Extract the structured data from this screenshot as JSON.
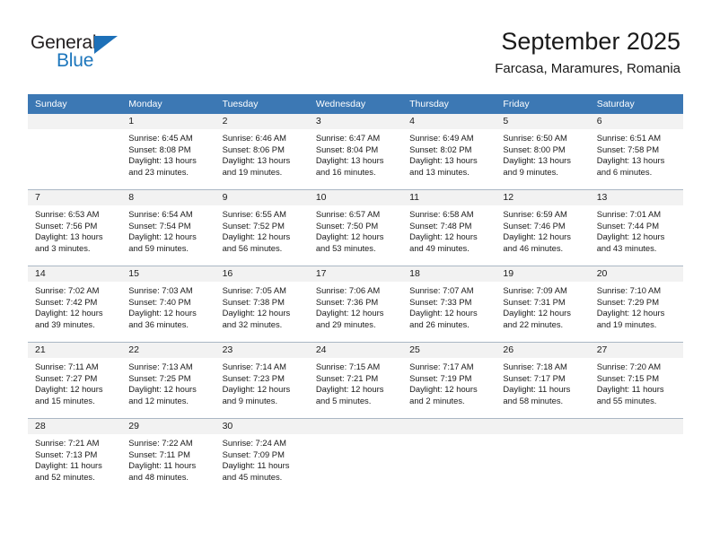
{
  "brand": {
    "name_top": "General",
    "name_bottom": "Blue",
    "accent_color": "#1c76bc",
    "triangle_color": "#1d70b8"
  },
  "header": {
    "title": "September 2025",
    "subtitle": "Farcasa, Maramures, Romania"
  },
  "calendar": {
    "header_color": "#3c78b4",
    "weekday_headers": [
      "Sunday",
      "Monday",
      "Tuesday",
      "Wednesday",
      "Thursday",
      "Friday",
      "Saturday"
    ],
    "weeks": [
      [
        {
          "day": "",
          "sunrise": "",
          "sunset": "",
          "daylight_line1": "",
          "daylight_line2": ""
        },
        {
          "day": "1",
          "sunrise": "Sunrise: 6:45 AM",
          "sunset": "Sunset: 8:08 PM",
          "daylight_line1": "Daylight: 13 hours",
          "daylight_line2": "and 23 minutes."
        },
        {
          "day": "2",
          "sunrise": "Sunrise: 6:46 AM",
          "sunset": "Sunset: 8:06 PM",
          "daylight_line1": "Daylight: 13 hours",
          "daylight_line2": "and 19 minutes."
        },
        {
          "day": "3",
          "sunrise": "Sunrise: 6:47 AM",
          "sunset": "Sunset: 8:04 PM",
          "daylight_line1": "Daylight: 13 hours",
          "daylight_line2": "and 16 minutes."
        },
        {
          "day": "4",
          "sunrise": "Sunrise: 6:49 AM",
          "sunset": "Sunset: 8:02 PM",
          "daylight_line1": "Daylight: 13 hours",
          "daylight_line2": "and 13 minutes."
        },
        {
          "day": "5",
          "sunrise": "Sunrise: 6:50 AM",
          "sunset": "Sunset: 8:00 PM",
          "daylight_line1": "Daylight: 13 hours",
          "daylight_line2": "and 9 minutes."
        },
        {
          "day": "6",
          "sunrise": "Sunrise: 6:51 AM",
          "sunset": "Sunset: 7:58 PM",
          "daylight_line1": "Daylight: 13 hours",
          "daylight_line2": "and 6 minutes."
        }
      ],
      [
        {
          "day": "7",
          "sunrise": "Sunrise: 6:53 AM",
          "sunset": "Sunset: 7:56 PM",
          "daylight_line1": "Daylight: 13 hours",
          "daylight_line2": "and 3 minutes."
        },
        {
          "day": "8",
          "sunrise": "Sunrise: 6:54 AM",
          "sunset": "Sunset: 7:54 PM",
          "daylight_line1": "Daylight: 12 hours",
          "daylight_line2": "and 59 minutes."
        },
        {
          "day": "9",
          "sunrise": "Sunrise: 6:55 AM",
          "sunset": "Sunset: 7:52 PM",
          "daylight_line1": "Daylight: 12 hours",
          "daylight_line2": "and 56 minutes."
        },
        {
          "day": "10",
          "sunrise": "Sunrise: 6:57 AM",
          "sunset": "Sunset: 7:50 PM",
          "daylight_line1": "Daylight: 12 hours",
          "daylight_line2": "and 53 minutes."
        },
        {
          "day": "11",
          "sunrise": "Sunrise: 6:58 AM",
          "sunset": "Sunset: 7:48 PM",
          "daylight_line1": "Daylight: 12 hours",
          "daylight_line2": "and 49 minutes."
        },
        {
          "day": "12",
          "sunrise": "Sunrise: 6:59 AM",
          "sunset": "Sunset: 7:46 PM",
          "daylight_line1": "Daylight: 12 hours",
          "daylight_line2": "and 46 minutes."
        },
        {
          "day": "13",
          "sunrise": "Sunrise: 7:01 AM",
          "sunset": "Sunset: 7:44 PM",
          "daylight_line1": "Daylight: 12 hours",
          "daylight_line2": "and 43 minutes."
        }
      ],
      [
        {
          "day": "14",
          "sunrise": "Sunrise: 7:02 AM",
          "sunset": "Sunset: 7:42 PM",
          "daylight_line1": "Daylight: 12 hours",
          "daylight_line2": "and 39 minutes."
        },
        {
          "day": "15",
          "sunrise": "Sunrise: 7:03 AM",
          "sunset": "Sunset: 7:40 PM",
          "daylight_line1": "Daylight: 12 hours",
          "daylight_line2": "and 36 minutes."
        },
        {
          "day": "16",
          "sunrise": "Sunrise: 7:05 AM",
          "sunset": "Sunset: 7:38 PM",
          "daylight_line1": "Daylight: 12 hours",
          "daylight_line2": "and 32 minutes."
        },
        {
          "day": "17",
          "sunrise": "Sunrise: 7:06 AM",
          "sunset": "Sunset: 7:36 PM",
          "daylight_line1": "Daylight: 12 hours",
          "daylight_line2": "and 29 minutes."
        },
        {
          "day": "18",
          "sunrise": "Sunrise: 7:07 AM",
          "sunset": "Sunset: 7:33 PM",
          "daylight_line1": "Daylight: 12 hours",
          "daylight_line2": "and 26 minutes."
        },
        {
          "day": "19",
          "sunrise": "Sunrise: 7:09 AM",
          "sunset": "Sunset: 7:31 PM",
          "daylight_line1": "Daylight: 12 hours",
          "daylight_line2": "and 22 minutes."
        },
        {
          "day": "20",
          "sunrise": "Sunrise: 7:10 AM",
          "sunset": "Sunset: 7:29 PM",
          "daylight_line1": "Daylight: 12 hours",
          "daylight_line2": "and 19 minutes."
        }
      ],
      [
        {
          "day": "21",
          "sunrise": "Sunrise: 7:11 AM",
          "sunset": "Sunset: 7:27 PM",
          "daylight_line1": "Daylight: 12 hours",
          "daylight_line2": "and 15 minutes."
        },
        {
          "day": "22",
          "sunrise": "Sunrise: 7:13 AM",
          "sunset": "Sunset: 7:25 PM",
          "daylight_line1": "Daylight: 12 hours",
          "daylight_line2": "and 12 minutes."
        },
        {
          "day": "23",
          "sunrise": "Sunrise: 7:14 AM",
          "sunset": "Sunset: 7:23 PM",
          "daylight_line1": "Daylight: 12 hours",
          "daylight_line2": "and 9 minutes."
        },
        {
          "day": "24",
          "sunrise": "Sunrise: 7:15 AM",
          "sunset": "Sunset: 7:21 PM",
          "daylight_line1": "Daylight: 12 hours",
          "daylight_line2": "and 5 minutes."
        },
        {
          "day": "25",
          "sunrise": "Sunrise: 7:17 AM",
          "sunset": "Sunset: 7:19 PM",
          "daylight_line1": "Daylight: 12 hours",
          "daylight_line2": "and 2 minutes."
        },
        {
          "day": "26",
          "sunrise": "Sunrise: 7:18 AM",
          "sunset": "Sunset: 7:17 PM",
          "daylight_line1": "Daylight: 11 hours",
          "daylight_line2": "and 58 minutes."
        },
        {
          "day": "27",
          "sunrise": "Sunrise: 7:20 AM",
          "sunset": "Sunset: 7:15 PM",
          "daylight_line1": "Daylight: 11 hours",
          "daylight_line2": "and 55 minutes."
        }
      ],
      [
        {
          "day": "28",
          "sunrise": "Sunrise: 7:21 AM",
          "sunset": "Sunset: 7:13 PM",
          "daylight_line1": "Daylight: 11 hours",
          "daylight_line2": "and 52 minutes."
        },
        {
          "day": "29",
          "sunrise": "Sunrise: 7:22 AM",
          "sunset": "Sunset: 7:11 PM",
          "daylight_line1": "Daylight: 11 hours",
          "daylight_line2": "and 48 minutes."
        },
        {
          "day": "30",
          "sunrise": "Sunrise: 7:24 AM",
          "sunset": "Sunset: 7:09 PM",
          "daylight_line1": "Daylight: 11 hours",
          "daylight_line2": "and 45 minutes."
        },
        {
          "day": "",
          "sunrise": "",
          "sunset": "",
          "daylight_line1": "",
          "daylight_line2": ""
        },
        {
          "day": "",
          "sunrise": "",
          "sunset": "",
          "daylight_line1": "",
          "daylight_line2": ""
        },
        {
          "day": "",
          "sunrise": "",
          "sunset": "",
          "daylight_line1": "",
          "daylight_line2": ""
        },
        {
          "day": "",
          "sunrise": "",
          "sunset": "",
          "daylight_line1": "",
          "daylight_line2": ""
        }
      ]
    ]
  }
}
